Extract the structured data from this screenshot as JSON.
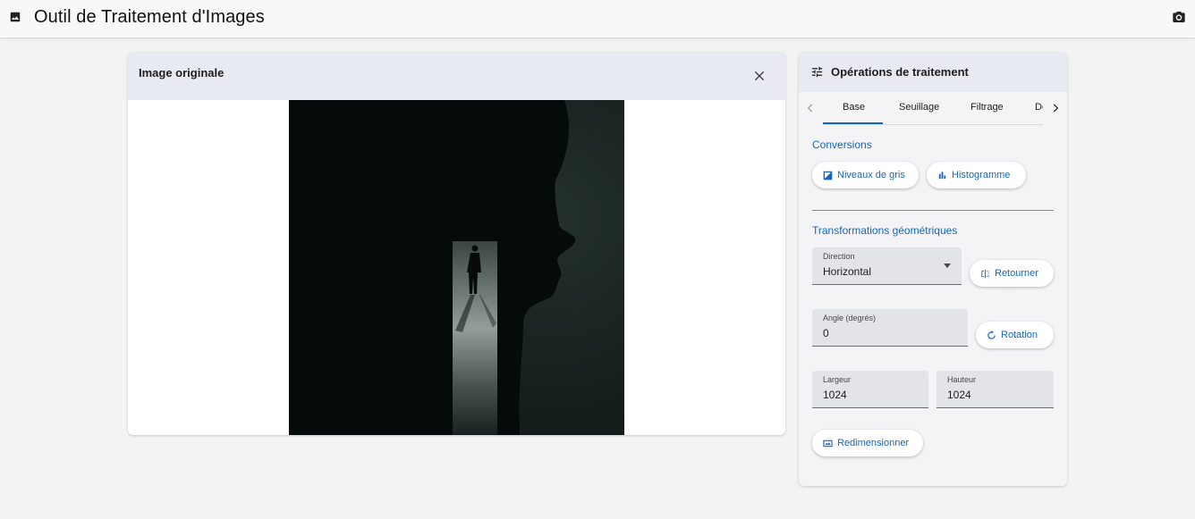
{
  "app": {
    "title": "Outil de Traitement d'Images",
    "icons": {
      "app": "image-icon",
      "screenshot": "camera-icon"
    }
  },
  "original": {
    "title": "Image originale",
    "close_icon": "close-icon"
  },
  "ops": {
    "title": "Opérations de traitement",
    "tabs": [
      {
        "label": "Base",
        "active": true
      },
      {
        "label": "Seuillage",
        "active": false
      },
      {
        "label": "Filtrage",
        "active": false
      },
      {
        "label": "De",
        "active": false
      }
    ],
    "conversions": {
      "title": "Conversions",
      "gray_label": "Niveaux de gris",
      "hist_label": "Histogramme"
    },
    "geometry": {
      "title": "Transformations géométriques",
      "direction_label": "Direction",
      "direction_value": "Horizontal",
      "flip_label": "Retourner",
      "angle_label": "Angle (degrés)",
      "angle_value": "0",
      "rotate_label": "Rotation",
      "width_label": "Largeur",
      "width_value": "1024",
      "height_label": "Hauteur",
      "height_value": "1024",
      "resize_label": "Redimensionner"
    }
  },
  "colors": {
    "accent": "#1565c0",
    "header_bg": "#e7eaf1",
    "field_bg": "#e3e4ea",
    "page_bg": "#f3f3f4"
  }
}
